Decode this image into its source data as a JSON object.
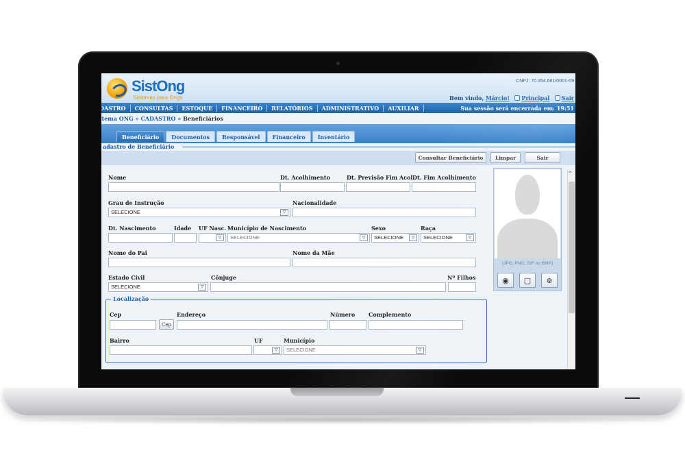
{
  "app": {
    "logo_name": "SistOng",
    "logo_tagline": "Sistemas para Ongs",
    "cnpj": "CNPJ: 70.354.661/0001-09",
    "welcome_prefix": "Bem vindo,",
    "user_name": "Márcio!",
    "link_principal": "Principal",
    "link_sair": "Sair",
    "session_text": "Sua sessão será encerrada em: 19:51"
  },
  "menu": {
    "items": [
      "DASTRO",
      "CONSULTAS",
      "ESTOQUE",
      "FINANCEIRO",
      "RELATÓRIOS",
      "ADMINISTRATIVO",
      "AUXILIAR"
    ]
  },
  "breadcrumb": {
    "root": "stema ONG",
    "sep1": "»",
    "section": "CADASTRO",
    "sep2": "»",
    "current": "Beneficiários"
  },
  "tabs": [
    "Beneficiário",
    "Documentos",
    "Responsável",
    "Financeiro",
    "Inventário"
  ],
  "active_tab": "Beneficiário",
  "section_title": "adastro de Beneficiário",
  "toolbar": {
    "consultar": "Consultar Beneficiário",
    "limpar": "Limpar",
    "sair": "Sair"
  },
  "form": {
    "nome": "Nome",
    "dt_acolhimento": "Dt. Acolhimento",
    "dt_previsao": "Dt. Previsão Fim Acol.",
    "dt_fim": "Dt. Fim Acolhimento",
    "grau_instrucao": "Grau de Instrução",
    "grau_value": "SELECIONE",
    "nacionalidade": "Nacionalidade",
    "dt_nascimento": "Dt. Nascimento",
    "idade": "Idade",
    "uf_nasc": "UF Nasc.",
    "municipio_nasc": "Município de Nascimento",
    "municipio_nasc_value": "SELECIONE",
    "sexo": "Sexo",
    "sexo_value": "SELECIONE",
    "raca": "Raça",
    "raca_value": "SELECIONE",
    "nome_pai": "Nome do Pai",
    "nome_mae": "Nome da Mãe",
    "estado_civil": "Estado Civil",
    "estado_civil_value": "SELECIONE",
    "conjuge": "Cônjuge",
    "n_filhos": "Nº Filhos"
  },
  "localizacao": {
    "legend": "Localização",
    "cep": "Cep",
    "cep_button": "Cep",
    "endereco": "Endereço",
    "numero": "Número",
    "complemento": "Complemento",
    "bairro": "Bairro",
    "uf": "UF",
    "municipio": "Município",
    "municipio_value": "SELECIONE"
  },
  "photo": {
    "caption": "(JPG, PNG, GIF ou BMP)",
    "icons": [
      "webcam-icon",
      "document-icon",
      "fingerprint-icon"
    ]
  }
}
